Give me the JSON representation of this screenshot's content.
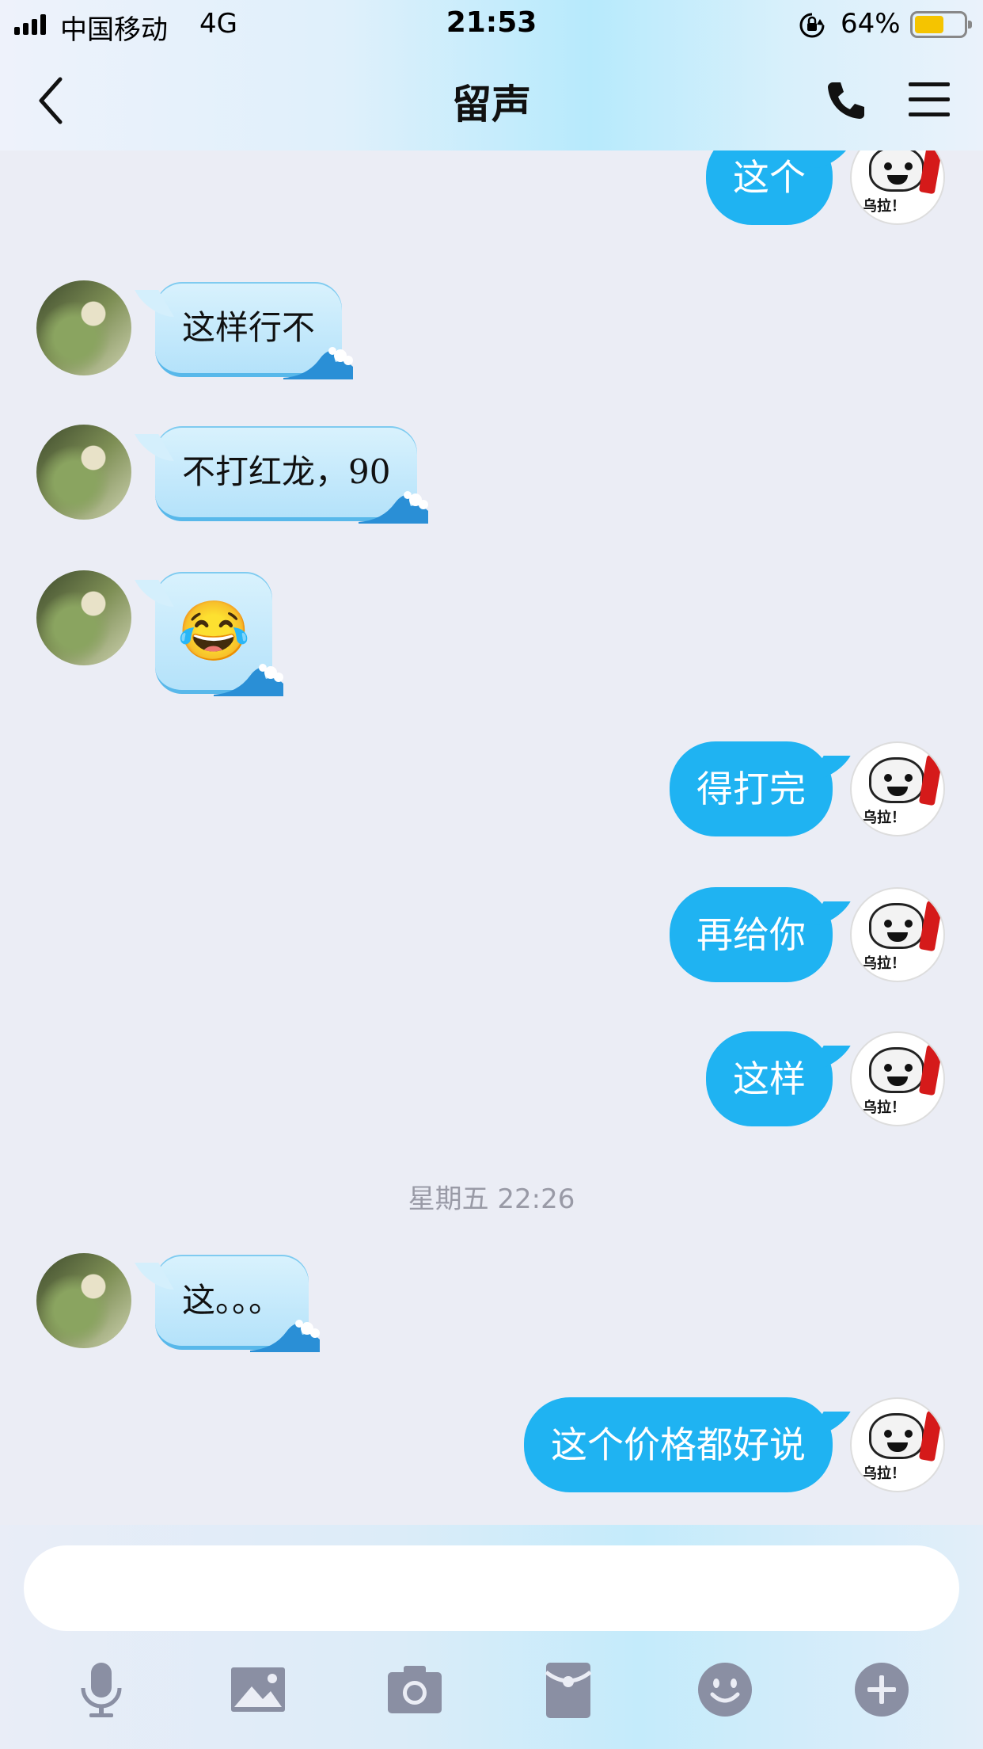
{
  "status_bar": {
    "carrier": "中国移动",
    "network": "4G",
    "time": "21:53",
    "battery": "64%"
  },
  "nav": {
    "title": "留声"
  },
  "messages": [
    {
      "side": "out",
      "text": "这个"
    },
    {
      "side": "in",
      "text": "这样行不"
    },
    {
      "side": "in",
      "text": "不打红龙，90"
    },
    {
      "side": "in",
      "text": "😂"
    },
    {
      "side": "out",
      "text": "得打完"
    },
    {
      "side": "out",
      "text": "再给你"
    },
    {
      "side": "out",
      "text": "这样"
    },
    {
      "side": "in",
      "text": "这。。。"
    },
    {
      "side": "out",
      "text": "这个价格都好说"
    }
  ],
  "timestamp": "星期五 22:26",
  "avatar_sticker_text": "乌拉！",
  "input": {
    "value": ""
  },
  "toolbar": [
    "mic-icon",
    "image-icon",
    "camera-icon",
    "red-packet-icon",
    "emoji-icon",
    "plus-icon"
  ],
  "colors": {
    "outgoing_bubble": "#1fb3f2",
    "incoming_bubble": "#c6e9fb",
    "background": "#ebedf5",
    "battery_fill": "#f5c400"
  }
}
